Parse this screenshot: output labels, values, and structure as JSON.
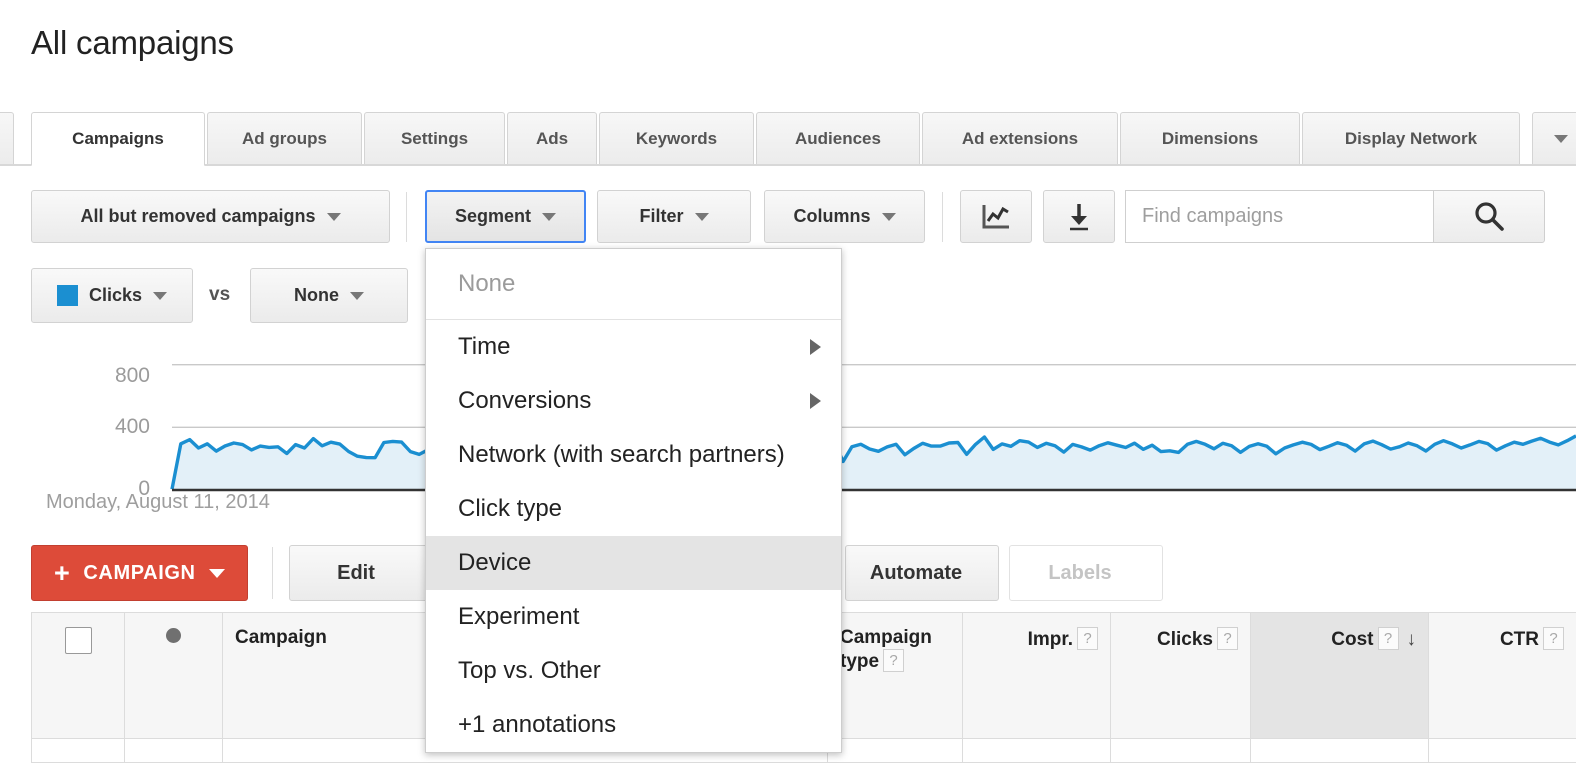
{
  "page": {
    "title": "All campaigns"
  },
  "tabs": [
    {
      "label": "Campaigns",
      "active": true
    },
    {
      "label": "Ad groups",
      "active": false
    },
    {
      "label": "Settings",
      "active": false
    },
    {
      "label": "Ads",
      "active": false
    },
    {
      "label": "Keywords",
      "active": false
    },
    {
      "label": "Audiences",
      "active": false
    },
    {
      "label": "Ad extensions",
      "active": false
    },
    {
      "label": "Dimensions",
      "active": false
    },
    {
      "label": "Display Network",
      "active": false
    }
  ],
  "toolbar": {
    "campaign_filter_label": "All but removed campaigns",
    "segment_label": "Segment",
    "filter_label": "Filter",
    "columns_label": "Columns",
    "chart_icon": "line-chart-icon",
    "download_icon": "download-icon",
    "search_icon": "search-icon",
    "search_placeholder": "Find campaigns",
    "search_value": ""
  },
  "metric_row": {
    "primary_metric": "Clicks",
    "primary_metric_color": "#1b8fd1",
    "vs_label": "vs",
    "secondary_metric": "None"
  },
  "segment_menu": {
    "none_label": "None",
    "items": [
      {
        "label": "Time",
        "submenu": true,
        "highlighted": false
      },
      {
        "label": "Conversions",
        "submenu": true,
        "highlighted": false
      },
      {
        "label": "Network (with search partners)",
        "submenu": false,
        "highlighted": false
      },
      {
        "label": "Click type",
        "submenu": false,
        "highlighted": false
      },
      {
        "label": "Device",
        "submenu": false,
        "highlighted": true
      },
      {
        "label": "Experiment",
        "submenu": false,
        "highlighted": false
      },
      {
        "label": "Top vs. Other",
        "submenu": false,
        "highlighted": false
      },
      {
        "label": "+1 annotations",
        "submenu": false,
        "highlighted": false
      }
    ]
  },
  "actions": {
    "campaign_button": "CAMPAIGN",
    "campaign_plus": "+",
    "edit_label": "Edit",
    "automate_label": "Automate",
    "labels_label": "Labels"
  },
  "table": {
    "columns": [
      {
        "label": "",
        "name": "select-all",
        "type": "checkbox"
      },
      {
        "label": "",
        "name": "status",
        "type": "dot"
      },
      {
        "label": "Campaign",
        "name": "campaign",
        "help": false
      },
      {
        "label": "Campaign type",
        "name": "campaign-type",
        "help": true
      },
      {
        "label": "Impr.",
        "name": "impressions",
        "help": true,
        "align": "right"
      },
      {
        "label": "Clicks",
        "name": "clicks",
        "help": true,
        "align": "right"
      },
      {
        "label": "Cost",
        "name": "cost",
        "help": true,
        "align": "right",
        "sorted": "desc",
        "sort_glyph": "↓"
      },
      {
        "label": "CTR",
        "name": "ctr",
        "help": true,
        "align": "right"
      }
    ],
    "help_glyph": "?",
    "rows": []
  },
  "chart_data": {
    "type": "area",
    "title": "",
    "series_name": "Clicks",
    "line_color": "#1b8fd1",
    "fill_color": "#e3f0f8",
    "ylabel": "",
    "xlabel": "",
    "ylim": [
      0,
      900
    ],
    "yticks": [
      0,
      400,
      800
    ],
    "ytick_labels": [
      "0",
      "400",
      "800"
    ],
    "grid": true,
    "x_start_label": "Monday, August 11, 2014",
    "values": [
      5,
      295,
      322,
      268,
      295,
      248,
      281,
      300,
      290,
      256,
      280,
      272,
      276,
      233,
      290,
      268,
      328,
      282,
      305,
      293,
      246,
      216,
      207,
      206,
      303,
      310,
      306,
      245,
      227,
      257,
      245,
      282,
      296,
      177,
      226,
      269,
      255,
      232,
      291,
      300,
      262,
      246,
      290,
      325,
      331,
      296,
      288,
      264,
      291,
      238,
      226,
      215,
      240,
      196,
      214,
      234,
      258,
      226,
      232,
      211,
      248,
      283,
      256,
      240,
      223,
      268,
      310,
      289,
      246,
      300,
      272,
      262,
      310,
      271,
      290,
      306,
      182,
      276,
      292,
      262,
      247,
      275,
      292,
      225,
      265,
      298,
      280,
      280,
      300,
      303,
      228,
      291,
      338,
      259,
      294,
      279,
      315,
      306,
      272,
      298,
      282,
      242,
      291,
      275,
      255,
      283,
      301,
      286,
      271,
      299,
      260,
      286,
      245,
      250,
      240,
      292,
      310,
      292,
      263,
      298,
      282,
      240,
      278,
      295,
      279,
      231,
      268,
      288,
      305,
      291,
      258,
      279,
      302,
      286,
      248,
      294,
      312,
      289,
      261,
      276,
      300,
      282,
      249,
      292,
      315,
      294,
      268,
      288,
      310,
      296,
      255,
      282,
      305,
      292,
      312,
      330,
      306,
      288,
      315,
      345
    ]
  }
}
